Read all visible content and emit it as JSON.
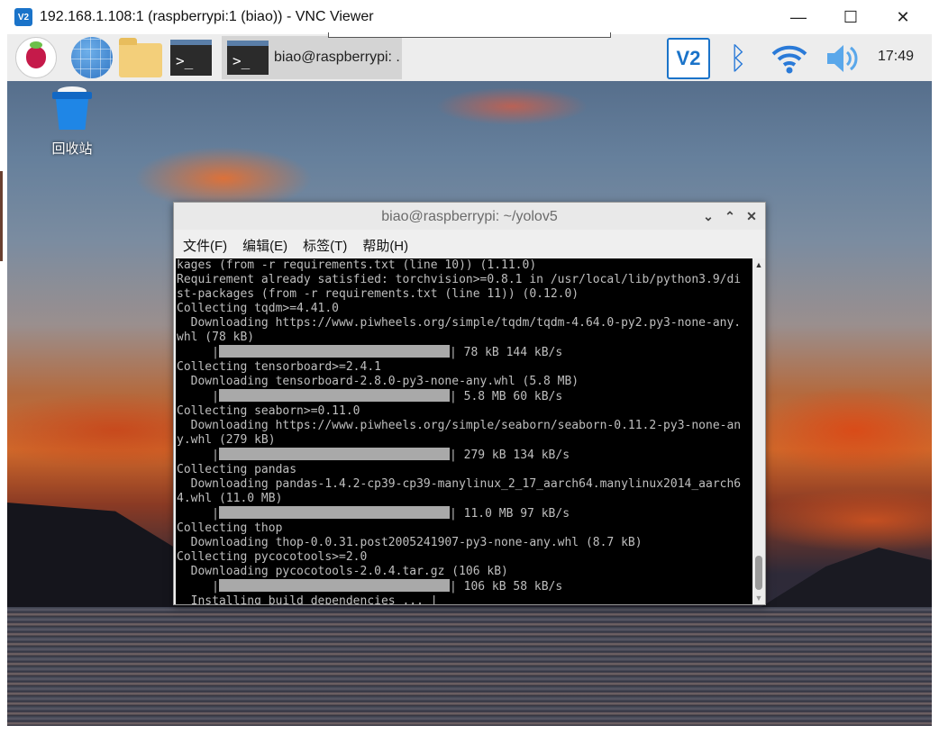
{
  "vnc_window": {
    "logo": "V2",
    "title": "192.168.1.108:1 (raspberrypi:1 (biao)) - VNC Viewer",
    "minimize": "—",
    "maximize": "☐",
    "close": "✕"
  },
  "taskbar": {
    "raspberry_menu_icon": "raspberry-pi-icon",
    "browser_icon": "globe-icon",
    "files_icon": "folder-icon",
    "terminal_glyph": ">_",
    "active_task": {
      "glyph": ">_",
      "label": "biao@raspberrypi: ..."
    },
    "tray": {
      "vnc_label": "V2",
      "bluetooth_glyph": "ᛒ",
      "clock": "17:49"
    }
  },
  "desktop": {
    "trash_label": "回收站"
  },
  "terminal": {
    "title": "biao@raspberrypi: ~/yolov5",
    "controls": {
      "minimize": "⌄",
      "maximize": "⌃",
      "close": "✕"
    },
    "menu": [
      "文件(F)",
      "编辑(E)",
      "标签(T)",
      "帮助(H)"
    ],
    "lines": [
      "kages (from -r requirements.txt (line 10)) (1.11.0)",
      "Requirement already satisfied: torchvision>=0.8.1 in /usr/local/lib/python3.9/di",
      "st-packages (from -r requirements.txt (line 11)) (0.12.0)",
      "Collecting tqdm>=4.41.0",
      "  Downloading https://www.piwheels.org/simple/tqdm/tqdm-4.64.0-py2.py3-none-any.",
      "whl (78 kB)",
      "     |",
      "Collecting tensorboard>=2.4.1",
      "  Downloading tensorboard-2.8.0-py3-none-any.whl (5.8 MB)",
      "     |",
      "Collecting seaborn>=0.11.0",
      "  Downloading https://www.piwheels.org/simple/seaborn/seaborn-0.11.2-py3-none-an",
      "y.whl (279 kB)",
      "     |",
      "Collecting pandas",
      "  Downloading pandas-1.4.2-cp39-cp39-manylinux_2_17_aarch64.manylinux2014_aarch6",
      "4.whl (11.0 MB)",
      "     |",
      "Collecting thop",
      "  Downloading thop-0.0.31.post2005241907-py3-none-any.whl (8.7 kB)",
      "Collecting pycocotools>=2.0",
      "  Downloading pycocotools-2.0.4.tar.gz (106 kB)",
      "     |",
      "  Installing build dependencies ... |"
    ],
    "progress_suffixes": {
      "tqdm": "| 78 kB 144 kB/s",
      "tensorboard": "| 5.8 MB 60 kB/s",
      "seaborn": "| 279 kB 134 kB/s",
      "pandas": "| 11.0 MB 97 kB/s",
      "pycocotools": "| 106 kB 58 kB/s"
    },
    "scroll": {
      "up": "▲",
      "down": "▼"
    }
  }
}
